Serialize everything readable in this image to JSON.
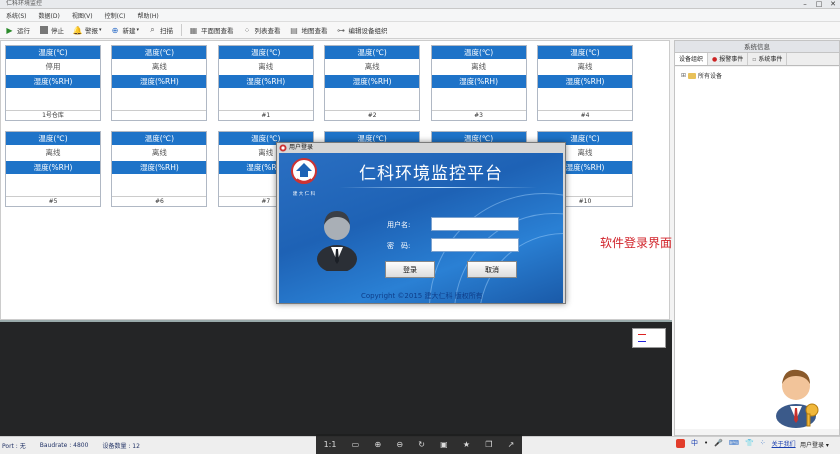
{
  "window": {
    "title": "仁科环境监控",
    "controls": [
      "–",
      "□",
      "✕"
    ]
  },
  "menu": [
    "系统(S)",
    "数据(D)",
    "视图(V)",
    "控制(C)",
    "帮助(H)"
  ],
  "toolbar": {
    "run": "运行",
    "stop": "停止",
    "alarm": "警报",
    "new": "新建",
    "scan": "扫描",
    "floor_view": "平面图查看",
    "list_view": "列表查看",
    "map_view": "地图查看",
    "edit_org": "编辑设备组织"
  },
  "cards": {
    "temp_header": "温度(℃)",
    "humid_header": "湿度(%RH)",
    "items": [
      {
        "status": "停用",
        "label": "1号仓库"
      },
      {
        "status": "离线",
        "label": ""
      },
      {
        "status": "离线",
        "label": "#1"
      },
      {
        "status": "离线",
        "label": "#2"
      },
      {
        "status": "离线",
        "label": "#3"
      },
      {
        "status": "离线",
        "label": "#4"
      },
      {
        "status": "离线",
        "label": "#5"
      },
      {
        "status": "离线",
        "label": "#6"
      },
      {
        "status": "离线",
        "label": "#7"
      },
      {
        "status": "",
        "label": ""
      },
      {
        "status": "",
        "label": ""
      },
      {
        "status": "离线",
        "label": "#10"
      }
    ]
  },
  "side_panel": {
    "title": "系统信息",
    "tabs": [
      "设备组织",
      "报警事件",
      "系统事件"
    ],
    "tree_root": "所有设备"
  },
  "status_bar": {
    "port": "Port : 无",
    "baudrate": "Baudrate : 4800",
    "device_count": "设备数量 : 12"
  },
  "tray": {
    "ime": "中",
    "link": "关于我们",
    "user_login": "用户登录 ▾"
  },
  "viewer": {
    "ratio": "1:1"
  },
  "annotation": "软件登录界面",
  "login_dialog": {
    "title": "用户登录",
    "heading": "仁科环境监控平台",
    "logo_text": "建 大 仁 科",
    "username_label": "用户名:",
    "password_label": "密　码:",
    "username_value": "",
    "password_value": "",
    "login_button": "登录",
    "cancel_button": "取消",
    "copyright": "Copyright ©2015 建大仁科 版权所有"
  }
}
